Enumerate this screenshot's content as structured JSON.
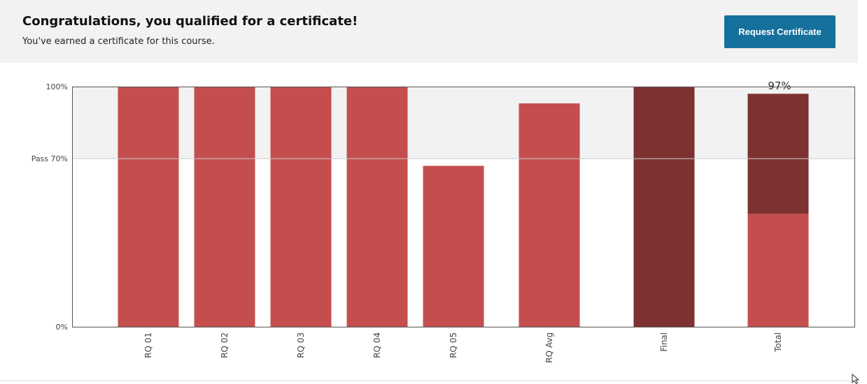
{
  "banner": {
    "title": "Congratulations, you qualified for a certificate!",
    "subtitle": "You've earned a certificate for this course.",
    "button_label": "Request Certificate"
  },
  "colors": {
    "banner_bg": "#f2f2f2",
    "button_bg": "#16709c",
    "bar": "#c44e4e",
    "bar_dark": "#7e3131",
    "pass_band": "#f2f2f2"
  },
  "chart_data": {
    "type": "bar",
    "ylim": [
      0,
      100
    ],
    "y_ticks": [
      {
        "value": 100,
        "label": "100%"
      },
      {
        "value": 70,
        "label": "Pass 70%"
      },
      {
        "value": 0,
        "label": "0%"
      }
    ],
    "pass_threshold": 70,
    "categories": [
      "RQ 01",
      "RQ 02",
      "RQ 03",
      "RQ 04",
      "RQ 05",
      "RQ Avg",
      "Final",
      "Total"
    ],
    "bars": [
      {
        "category": "RQ 01",
        "value": 100,
        "tone": "light"
      },
      {
        "category": "RQ 02",
        "value": 100,
        "tone": "light"
      },
      {
        "category": "RQ 03",
        "value": 100,
        "tone": "light"
      },
      {
        "category": "RQ 04",
        "value": 100,
        "tone": "light"
      },
      {
        "category": "RQ 05",
        "value": 67,
        "tone": "light"
      },
      {
        "category": "RQ Avg",
        "value": 93,
        "tone": "light"
      },
      {
        "category": "Final",
        "value": 100,
        "tone": "dark"
      },
      {
        "category": "Total",
        "value": 97,
        "tone": "stacked",
        "segments": [
          {
            "value": 47,
            "tone": "light"
          },
          {
            "value": 50,
            "tone": "dark"
          }
        ]
      }
    ],
    "annotations": [
      {
        "category": "Total",
        "text": "97%"
      }
    ]
  }
}
